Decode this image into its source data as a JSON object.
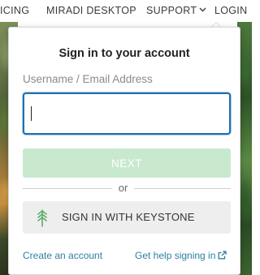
{
  "nav": {
    "pricing": "ICING",
    "desktop": "MIRADI DESKTOP",
    "support": "SUPPORT",
    "login": "LOGIN"
  },
  "signin": {
    "title": "Sign in to your account",
    "username_label": "Username / Email Address",
    "username_value": "",
    "next_label": "NEXT",
    "divider_text": "or",
    "keystone_label": "SIGN IN WITH KEYSTONE",
    "create_account": "Create an account",
    "help_signing_in": "Get help signing in"
  },
  "icons": {
    "support_dropdown": "chevron-down-icon",
    "keystone": "keystone-tree-icon",
    "help_link": "external-link-icon"
  },
  "colors": {
    "input_focus_border": "#1f6fb2",
    "next_button_disabled": "#c9e9cf",
    "keystone_icon": "#5cae6b",
    "link": "#2e7fa0"
  }
}
